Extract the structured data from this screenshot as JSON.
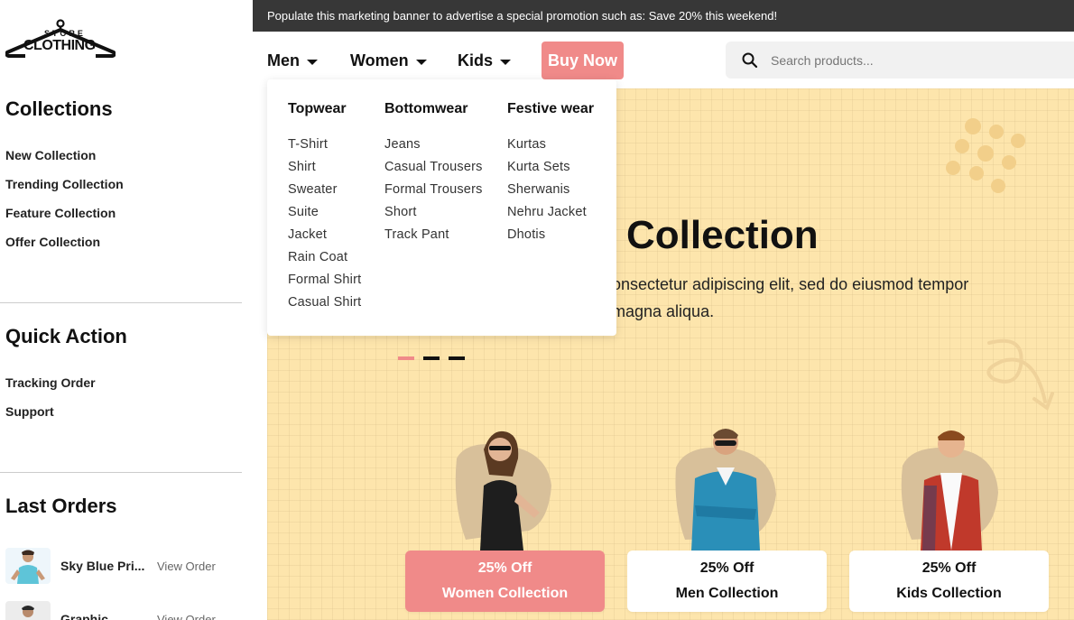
{
  "sidebar": {
    "logo": {
      "top": "STORE",
      "bottom": "CLOTHING"
    },
    "collections": {
      "title": "Collections",
      "items": [
        "New Collection",
        "Trending Collection",
        "Feature Collection",
        "Offer Collection"
      ]
    },
    "quick_action": {
      "title": "Quick Action",
      "items": [
        "Tracking Order",
        "Support"
      ]
    },
    "last_orders": {
      "title": "Last Orders",
      "orders": [
        {
          "name": "Sky Blue Pri...",
          "link": "View Order"
        },
        {
          "name": "Graphic",
          "link": "View Order"
        }
      ]
    }
  },
  "promo_banner": "Populate this marketing banner to advertise a special promotion such as: Save 20% this weekend!",
  "nav": {
    "items": [
      "Men",
      "Women",
      "Kids"
    ],
    "buy_now": "Buy Now",
    "search_placeholder": "Search products..."
  },
  "mega_menu": {
    "columns": [
      {
        "title": "Topwear",
        "items": [
          "T-Shirt",
          "Shirt",
          "Sweater",
          "Suite",
          "Jacket",
          "Rain Coat",
          "Formal Shirt",
          "Casual Shirt"
        ]
      },
      {
        "title": "Bottomwear",
        "items": [
          "Jeans",
          "Casual Trousers",
          "Formal Trousers",
          "Short",
          "Track Pant"
        ]
      },
      {
        "title": "Festive wear",
        "items": [
          "Kurtas",
          "Kurta Sets",
          "Sherwanis",
          "Nehru Jacket",
          "Dhotis"
        ]
      }
    ]
  },
  "hero": {
    "title": "Collection",
    "description": "onsectetur adipiscing elit, sed do eiusmod tempor magna aliqua.",
    "description_line1": "onsectetur adipiscing elit, sed do eiusmod tempor",
    "description_line2": "magna aliqua.",
    "slide_count": 3,
    "active_slide": 1
  },
  "categories": [
    {
      "discount": "25% Off",
      "label": "Women Collection"
    },
    {
      "discount": "25% Off",
      "label": "Men Collection"
    },
    {
      "discount": "25% Off",
      "label": "Kids Collection"
    }
  ],
  "colors": {
    "accent": "#f08a89",
    "hero_bg": "#fde5ac",
    "banner_bg": "#373737"
  },
  "icons": {
    "logo": "hanger-logo-icon",
    "search": "search-icon",
    "dropdown": "caret-down-icon"
  }
}
